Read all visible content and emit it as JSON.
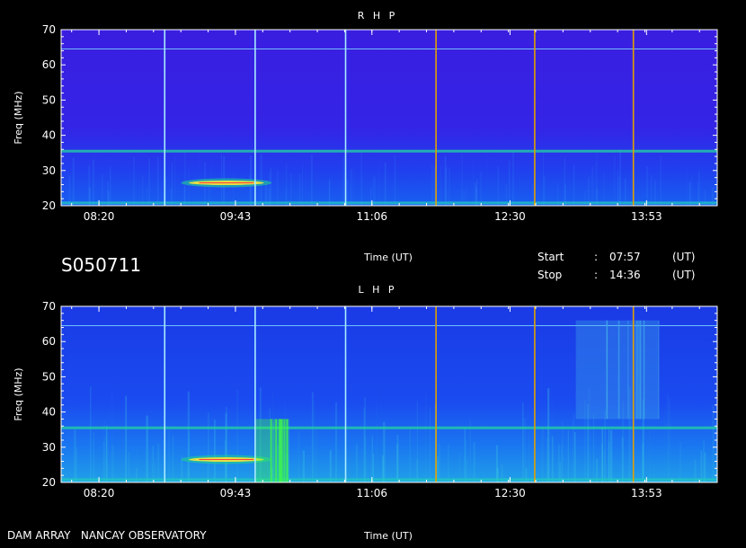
{
  "session_id": "S050711",
  "footer": "DAM ARRAY   NANCAY OBSERVATORY",
  "info": {
    "start_label": "Start",
    "stop_label": "Stop",
    "sep": ":",
    "start_time": "07:57",
    "stop_time": "14:36",
    "unit": "(UT)"
  },
  "colors": {
    "background": "#000000",
    "rhp_base": "#3a20e6",
    "lhp_base": "#1a46ee",
    "vline_light": "#a8ecff",
    "vline_orange": "#e0a000",
    "axis": "#ffffff"
  },
  "chart_data": [
    {
      "type": "heatmap",
      "title": "R H P",
      "xlabel": "Time (UT)",
      "ylabel": "Freq (MHz)",
      "x_range": [
        "07:57",
        "14:36"
      ],
      "ylim": [
        20,
        70
      ],
      "x_ticks": [
        "08:20",
        "09:43",
        "11:06",
        "12:30",
        "13:53"
      ],
      "y_ticks": [
        20,
        30,
        40,
        50,
        60,
        70
      ],
      "vertical_lines": [
        {
          "time": "09:00",
          "color": "light"
        },
        {
          "time": "09:55",
          "color": "light"
        },
        {
          "time": "10:50",
          "color": "light"
        },
        {
          "time": "11:45",
          "color": "orange"
        },
        {
          "time": "12:45",
          "color": "orange"
        },
        {
          "time": "13:45",
          "color": "orange"
        }
      ],
      "features": [
        {
          "type": "horizontal_line",
          "freq": 64.5,
          "start": "07:57",
          "end": "14:36",
          "color": "#7fd8ff"
        },
        {
          "type": "horizontal_band",
          "freq": 35.5,
          "start": "07:57",
          "end": "14:36",
          "color": "#22d6a0"
        },
        {
          "type": "horizontal_band",
          "freq": 20.8,
          "start": "07:57",
          "end": "14:36",
          "color": "#20c8c0"
        },
        {
          "type": "burst",
          "freq": 26.5,
          "start": "09:10",
          "end": "10:05",
          "color": "#f0e040"
        }
      ]
    },
    {
      "type": "heatmap",
      "title": "L H P",
      "xlabel": "Time (UT)",
      "ylabel": "Freq (MHz)",
      "x_range": [
        "07:57",
        "14:36"
      ],
      "ylim": [
        20,
        70
      ],
      "x_ticks": [
        "08:20",
        "09:43",
        "11:06",
        "12:30",
        "13:53"
      ],
      "y_ticks": [
        20,
        30,
        40,
        50,
        60,
        70
      ],
      "vertical_lines": [
        {
          "time": "09:00",
          "color": "light"
        },
        {
          "time": "09:55",
          "color": "light"
        },
        {
          "time": "10:50",
          "color": "light"
        },
        {
          "time": "11:45",
          "color": "orange"
        },
        {
          "time": "12:45",
          "color": "orange"
        },
        {
          "time": "13:45",
          "color": "orange"
        }
      ],
      "features": [
        {
          "type": "horizontal_line",
          "freq": 64.5,
          "start": "07:57",
          "end": "14:36",
          "color": "#7fd8ff"
        },
        {
          "type": "horizontal_band",
          "freq": 35.5,
          "start": "07:57",
          "end": "14:36",
          "color": "#22d6a0"
        },
        {
          "type": "horizontal_band",
          "freq": 20.8,
          "start": "07:57",
          "end": "14:36",
          "color": "#20c8c0"
        },
        {
          "type": "burst",
          "freq": 26.5,
          "start": "09:10",
          "end": "10:05",
          "color": "#f0e040"
        },
        {
          "type": "storm",
          "freq_low": 20,
          "freq_high": 38,
          "start": "09:55",
          "end": "10:15",
          "color": "#40ff40"
        },
        {
          "type": "storm",
          "freq_low": 38,
          "freq_high": 66,
          "start": "13:10",
          "end": "14:00",
          "color": "#3fa8e8"
        }
      ]
    }
  ]
}
